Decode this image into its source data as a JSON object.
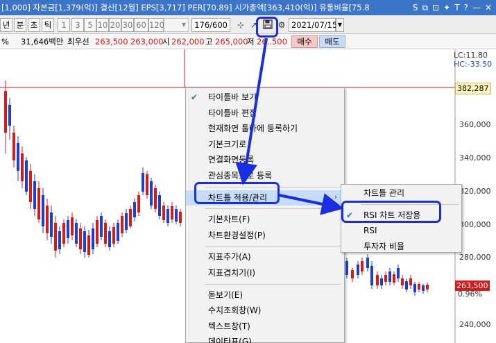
{
  "title_bar": {
    "text": "[1,000] 자본금[1,379(억)] 결산[12월] EPS[3,717] PER[70.89] 시가총액[363,410(억)] 유통비율[75.8",
    "icons": [
      "S",
      "⧉",
      "⊡",
      "✦",
      "T",
      "?",
      "—",
      "✕"
    ]
  },
  "toolbar": {
    "periods": [
      "년",
      "분",
      "초",
      "틱"
    ],
    "intervals": [
      "1",
      "3",
      "5",
      "10",
      "20",
      "30",
      "60",
      "120"
    ],
    "count": "176",
    "count_total": "/600",
    "date": "2021/07/15"
  },
  "price_bar": {
    "percent_sign": "%",
    "volume": "31,646백만",
    "best_bid_label": "최우선",
    "best_bid": "263,500",
    "best_ask": "263,000",
    "open_label": "시",
    "open": "262,000",
    "high_label": "고",
    "high": "265,000",
    "low_label": "저",
    "low": "26..500",
    "buy_label": "매수",
    "sell_label": "매도"
  },
  "chart": {
    "lc": "LC:11.80",
    "hc": "HC:-33.50",
    "current_tag": "382,287",
    "price_labels": [
      "360,000",
      "340,000",
      "320,000",
      "300,000",
      "280,000",
      "240,000"
    ],
    "last_price": "263,500",
    "last_change": "0.96%",
    "colors": {
      "up": "#d21c1c",
      "down": "#1c3fd2",
      "hline": "#d21c1c"
    }
  },
  "context_menu": {
    "items": [
      {
        "label": "타이틀바 보기",
        "checked": true
      },
      {
        "label": "타이틀바 편집"
      },
      {
        "label": "현재화면 툴바에 등록하기"
      },
      {
        "label": "기본크기로"
      },
      {
        "label": "연결화면등록"
      },
      {
        "label": "관심종목으로 등록"
      },
      {
        "label": "차트틀 적용/관리",
        "submenu": true,
        "highlighted": true
      },
      {
        "label": "기본차트(F)"
      },
      {
        "label": "차트환경설정(P)"
      },
      {
        "label": "지표추가(A)"
      },
      {
        "label": "지표겹치기(I)"
      },
      {
        "label": "돋보기(E)"
      },
      {
        "label": "수치조회창(W)"
      },
      {
        "label": "텍스트창(T)"
      },
      {
        "label": "데이타표(G)"
      }
    ]
  },
  "submenu": {
    "items": [
      {
        "label": "차트틀 관리"
      },
      {
        "label": "RSI 차트 저장용",
        "checked": true
      },
      {
        "label": "RSI"
      },
      {
        "label": "투자자 비율"
      }
    ]
  }
}
